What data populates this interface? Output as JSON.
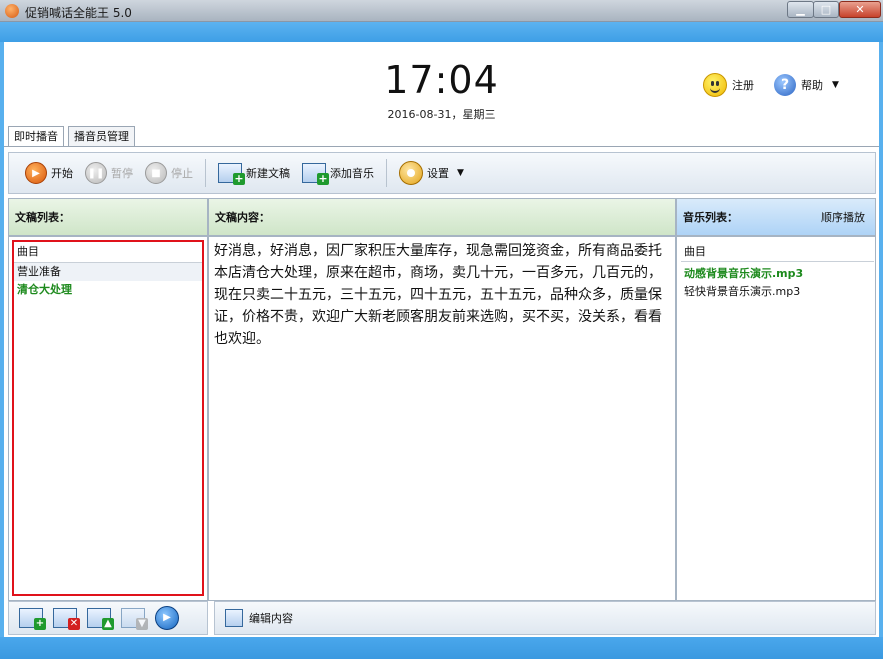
{
  "window": {
    "title": "促销喊话全能王 5.0",
    "min_icon": "minimize-icon",
    "max_icon": "maximize-icon",
    "close_icon": "close-icon"
  },
  "clock": {
    "time": "17:04",
    "date": "2016-08-31，星期三"
  },
  "header": {
    "register_label": "注册",
    "help_label": "帮助",
    "register_icon": "smiley-icon",
    "help_icon": "help-icon"
  },
  "tabs": [
    {
      "label": "即时播音",
      "active": true
    },
    {
      "label": "播音员管理",
      "active": false
    }
  ],
  "toolbar": {
    "start_label": "开始",
    "pause_label": "暂停",
    "stop_label": "停止",
    "new_script_label": "新建文稿",
    "add_music_label": "添加音乐",
    "settings_label": "设置"
  },
  "scripts": {
    "heading": "文稿列表：",
    "column": "曲目",
    "items": [
      {
        "label": "营业准备"
      },
      {
        "label": "清仓大处理"
      }
    ]
  },
  "content": {
    "heading": "文稿内容：",
    "text": "好消息，好消息，因厂家积压大量库存，现急需回笼资金，所有商品委托本店清仓大处理，原来在超市，商场，卖几十元，一百多元，几百元的，现在只卖二十五元，三十五元，四十五元，五十五元，品种众多，质量保证，价格不贵，欢迎广大新老顾客朋友前来选购，买不买，没关系，看看也欢迎。"
  },
  "music": {
    "heading": "音乐列表：",
    "mode": "顺序播放",
    "column": "曲目",
    "items": [
      {
        "label": "动感背景音乐演示.mp3"
      },
      {
        "label": "轻快背景音乐演示.mp3"
      }
    ]
  },
  "bottom": {
    "edit_label": "编辑内容"
  },
  "colors": {
    "accent_blue": "#3e9fe6",
    "selection_red": "#e0121b",
    "active_green": "#1d8a1d"
  }
}
